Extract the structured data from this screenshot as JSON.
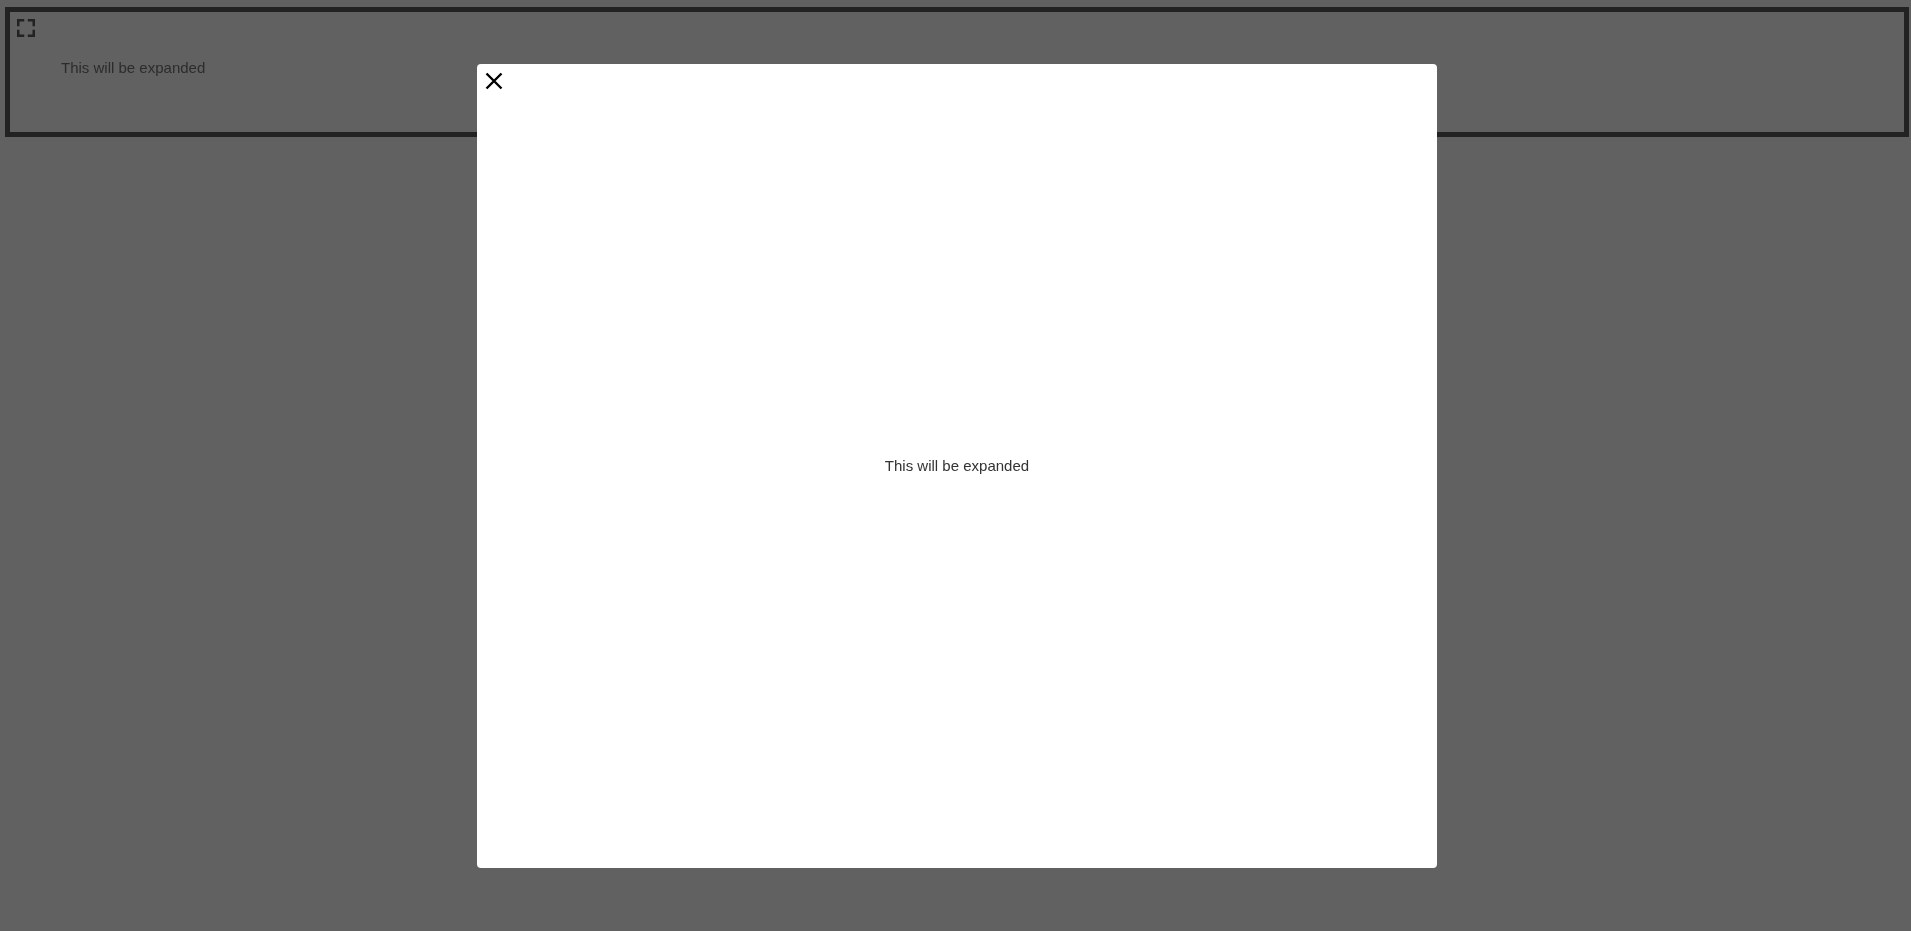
{
  "card": {
    "text": "This will be expanded"
  },
  "modal": {
    "open": true,
    "text": "This will be expanded"
  }
}
